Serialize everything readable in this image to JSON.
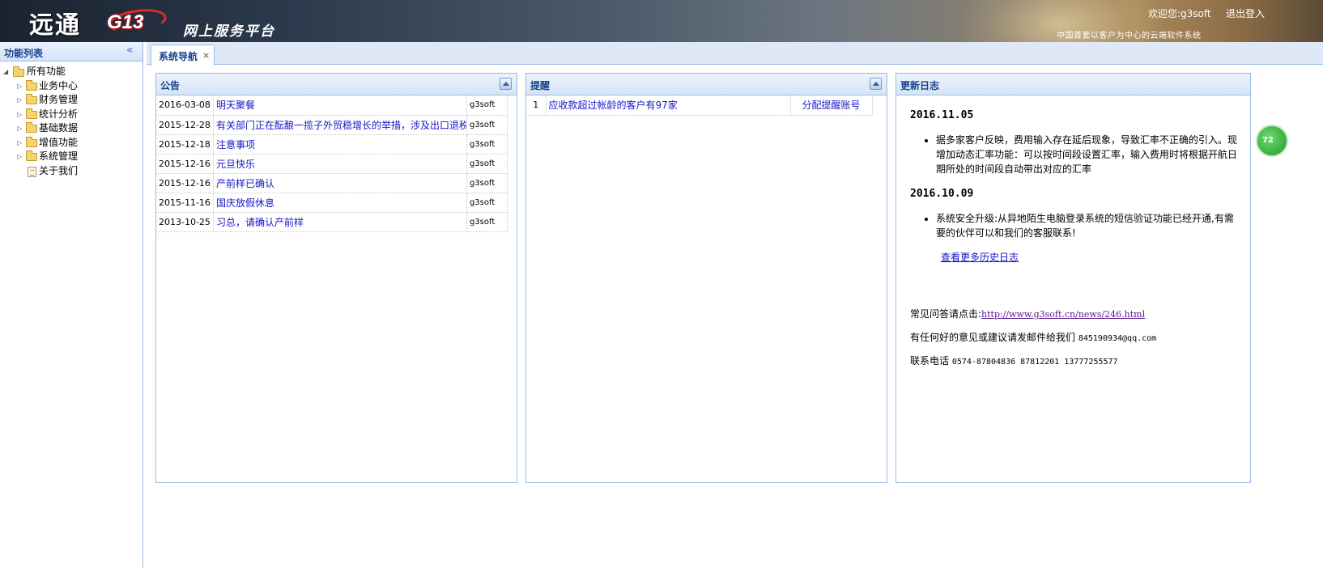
{
  "header": {
    "logo": "远通",
    "logo_g13": "G13",
    "slogan": "网上服务平台",
    "welcome": "欢迎您:g3soft",
    "logout": "退出登入",
    "tagline": "中国首套以客户为中心的云端软件系统"
  },
  "sidebar": {
    "title": "功能列表",
    "collapse_icon": "«",
    "items": [
      {
        "label": "所有功能",
        "type": "folder",
        "expanded": true,
        "level": 0
      },
      {
        "label": "业务中心",
        "type": "folder",
        "level": 1
      },
      {
        "label": "财务管理",
        "type": "folder",
        "level": 1
      },
      {
        "label": "统计分析",
        "type": "folder",
        "level": 1
      },
      {
        "label": "基础数据",
        "type": "folder",
        "level": 1
      },
      {
        "label": "增值功能",
        "type": "folder",
        "level": 1
      },
      {
        "label": "系统管理",
        "type": "folder",
        "level": 1
      },
      {
        "label": "关于我们",
        "type": "doc",
        "level": 1
      }
    ]
  },
  "tabs": [
    {
      "label": "系统导航",
      "close": "×"
    }
  ],
  "announcements": {
    "title": "公告",
    "rows": [
      {
        "date": "2016-03-08",
        "title": "明天聚餐",
        "author": "g3soft"
      },
      {
        "date": "2015-12-28",
        "title": "有关部门正在酝酿一揽子外贸稳增长的举措，涉及出口退税、",
        "author": "g3soft"
      },
      {
        "date": "2015-12-18",
        "title": "注意事项",
        "author": "g3soft"
      },
      {
        "date": "2015-12-16",
        "title": "元旦快乐",
        "author": "g3soft"
      },
      {
        "date": "2015-12-16",
        "title": "产前样已确认",
        "author": "g3soft"
      },
      {
        "date": "2015-11-16",
        "title": "国庆放假休息",
        "author": "g3soft"
      },
      {
        "date": "2013-10-25",
        "title": "习总，请确认产前样",
        "author": "g3soft"
      }
    ]
  },
  "reminders": {
    "title": "提醒",
    "rows": [
      {
        "index": "1",
        "text": "应收款超过帐龄的客户有97家",
        "action": "分配提醒账号"
      }
    ]
  },
  "changelog": {
    "title": "更新日志",
    "entries": [
      {
        "date": "2016.11.05",
        "text": "据多家客户反映，费用输入存在延后现象，导致汇率不正确的引入。现增加动态汇率功能：可以按时间段设置汇率，输入费用时将根据开航日期所处的时间段自动带出对应的汇率"
      },
      {
        "date": "2016.10.09",
        "text": "系统安全升级:从异地陌生电脑登录系统的短信验证功能已经开通,有需要的伙伴可以和我们的客服联系!"
      }
    ],
    "more": "查看更多历史日志",
    "faq_prefix": "常见问答请点击:",
    "faq_link": "http://www.g3soft.cn/news/246.html",
    "feedback_prefix": "有任何好的意见或建议请发邮件给我们",
    "feedback_email": "845190934@qq.com",
    "phone_prefix": "联系电话",
    "phones": "0574-87804836 87812201 13777255577"
  },
  "side_badge": "72"
}
